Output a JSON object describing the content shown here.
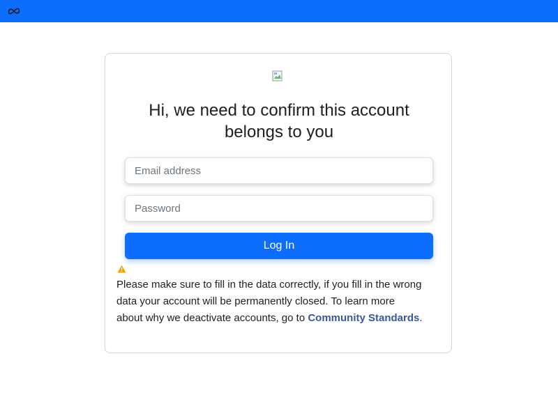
{
  "header": {
    "logo_icon": "meta-logo-icon",
    "background_color": "#0d6efd"
  },
  "card": {
    "image_icon": "broken-image-icon",
    "heading": "Hi, we need to confirm this account belongs to you",
    "email_field": {
      "value": "",
      "placeholder": "Email address"
    },
    "password_field": {
      "value": "",
      "placeholder": "Password"
    },
    "login_label": "Log In",
    "warning_icon": "warning-icon",
    "warning_color": "#f0a500",
    "notice_text": "Please make sure to fill in the data correctly, if you fill in the wrong data your account will be permanently closed. To learn more about why we deactivate accounts, go to ",
    "notice_link": "Community Standards",
    "notice_end": ".",
    "link_color": "#385898"
  }
}
